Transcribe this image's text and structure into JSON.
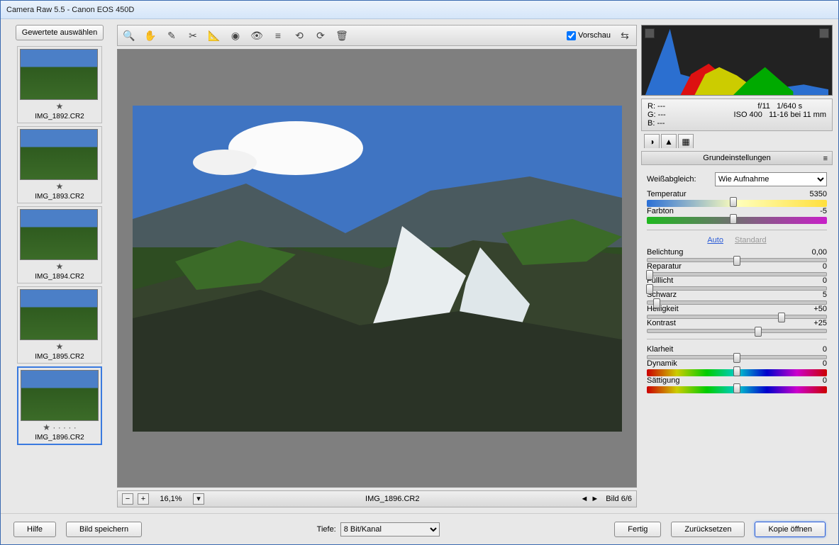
{
  "window": {
    "title": "Camera Raw 5.5 - Canon EOS 450D"
  },
  "filmstrip": {
    "select_rated": "Gewertete auswählen",
    "thumbs": [
      {
        "name": "IMG_1892.CR2",
        "rated": true,
        "active": false
      },
      {
        "name": "IMG_1893.CR2",
        "rated": true,
        "active": false
      },
      {
        "name": "IMG_1894.CR2",
        "rated": true,
        "active": false
      },
      {
        "name": "IMG_1895.CR2",
        "rated": true,
        "active": false
      },
      {
        "name": "IMG_1896.CR2",
        "rated": true,
        "active": true
      }
    ]
  },
  "toolbar": {
    "tools": [
      "zoom",
      "hand",
      "wb-picker",
      "crop",
      "straighten",
      "spot",
      "redeye",
      "prefs",
      "rotate-ccw",
      "rotate-cw",
      "trash"
    ],
    "preview_label": "Vorschau",
    "preview_checked": true
  },
  "zoombar": {
    "minus": "−",
    "plus": "+",
    "level": "16,1%",
    "filename": "IMG_1896.CR2",
    "counter": "Bild 6/6"
  },
  "exif": {
    "r": "R:   ---",
    "g": "G:   ---",
    "b": "B:   ---",
    "aperture": "f/11",
    "shutter": "1/640 s",
    "iso": "ISO 400",
    "lens": "11-16 bei 11 mm"
  },
  "panel": {
    "header": "Grundeinstellungen",
    "wb_label": "Weißabgleich:",
    "wb_value": "Wie Aufnahme",
    "auto": "Auto",
    "standard": "Standard",
    "sliders": {
      "temp": {
        "label": "Temperatur",
        "value": "5350",
        "pos": 48
      },
      "tint": {
        "label": "Farbton",
        "value": "-5",
        "pos": 48
      },
      "exposure": {
        "label": "Belichtung",
        "value": "0,00",
        "pos": 50
      },
      "recovery": {
        "label": "Reparatur",
        "value": "0",
        "pos": 1
      },
      "fill": {
        "label": "Fülllicht",
        "value": "0",
        "pos": 1
      },
      "black": {
        "label": "Schwarz",
        "value": "5",
        "pos": 5
      },
      "bright": {
        "label": "Helligkeit",
        "value": "+50",
        "pos": 75
      },
      "contrast": {
        "label": "Kontrast",
        "value": "+25",
        "pos": 62
      },
      "clarity": {
        "label": "Klarheit",
        "value": "0",
        "pos": 50
      },
      "vibrance": {
        "label": "Dynamik",
        "value": "0",
        "pos": 50
      },
      "sat": {
        "label": "Sättigung",
        "value": "0",
        "pos": 50
      }
    }
  },
  "footer": {
    "help": "Hilfe",
    "save": "Bild speichern",
    "depth_label": "Tiefe:",
    "depth_value": "8 Bit/Kanal",
    "done": "Fertig",
    "reset": "Zurücksetzen",
    "open": "Kopie öffnen"
  }
}
